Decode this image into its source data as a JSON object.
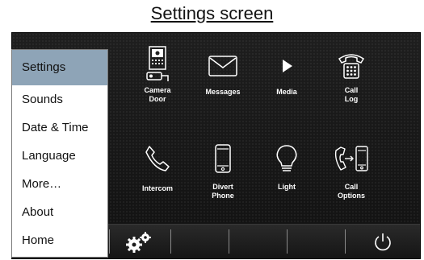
{
  "caption": "Settings screen",
  "menu": {
    "items": [
      {
        "label": "Settings",
        "active": true
      },
      {
        "label": "Sounds"
      },
      {
        "label": "Date & Time"
      },
      {
        "label": "Language"
      },
      {
        "label": "More…"
      },
      {
        "label": "About"
      },
      {
        "label": "Home"
      }
    ],
    "active_color": "#8ea4b7"
  },
  "tiles": [
    {
      "label": "Camera\nDoor",
      "icon": "camera-door-icon"
    },
    {
      "label": "Messages",
      "icon": "envelope-icon"
    },
    {
      "label": "Media",
      "icon": "play-icon"
    },
    {
      "label": "Call\nLog",
      "icon": "telephone-icon"
    },
    {
      "label": "Intercom",
      "icon": "phone-handset-icon"
    },
    {
      "label": "Divert\nPhone",
      "icon": "mobile-phone-icon"
    },
    {
      "label": "Light",
      "icon": "lightbulb-icon"
    },
    {
      "label": "Call\nOptions",
      "icon": "call-forward-icon"
    }
  ],
  "bottom_bar": {
    "icons": [
      "gears-icon",
      "power-icon"
    ]
  }
}
